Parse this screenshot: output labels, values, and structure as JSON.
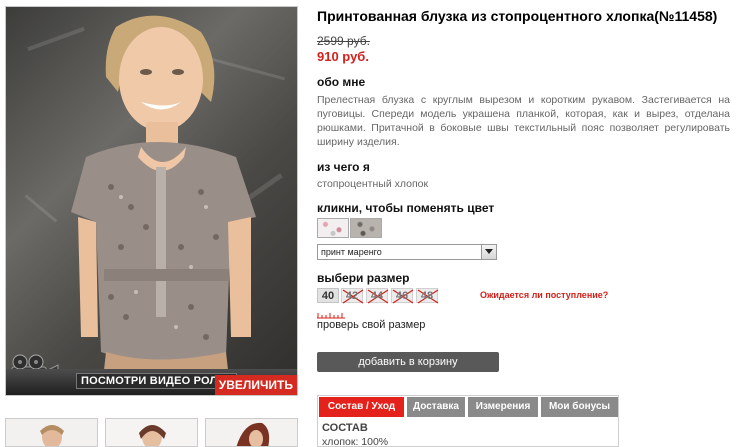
{
  "product": {
    "title": "Принтованная блузка из стопроцентного хлопка(№11458)",
    "old_price": "2599 руб.",
    "new_price": "910 руб."
  },
  "about": {
    "heading": "обо мне",
    "text": "Прелестная блузка с круглым вырезом и коротким рукавом. Застегивается на пуговицы. Спереди модель украшена планкой, которая, как и вырез, отделана рюшками. Притачной в боковые швы текстильный пояс позволяет регулировать ширину изделия."
  },
  "material": {
    "heading": "из чего я",
    "text": "стопроцентный хлопок"
  },
  "color": {
    "heading": "кликни, чтобы поменять цвет",
    "selected": "принт маренго"
  },
  "size": {
    "heading": "выбери размер",
    "options": [
      "40",
      "42",
      "44",
      "46",
      "48"
    ],
    "notify_link": "Ожидается ли поступление?",
    "check_link": "проверь свой размер"
  },
  "video_label": "посмотри видео ролик",
  "zoom_label": "УВЕЛИЧИТЬ",
  "cart_button": "добавить в корзину",
  "tabs": [
    "Состав / Уход",
    "Доставка",
    "Измерения",
    "Мои бонусы"
  ],
  "tab_content": {
    "heading": "СОСТАВ",
    "text": "хлопок: 100%"
  },
  "colors": {
    "price_red": "#d3201a",
    "tab_active": "#e4221b",
    "tab_inactive": "#8a8a8a",
    "button_dark": "#595959"
  }
}
